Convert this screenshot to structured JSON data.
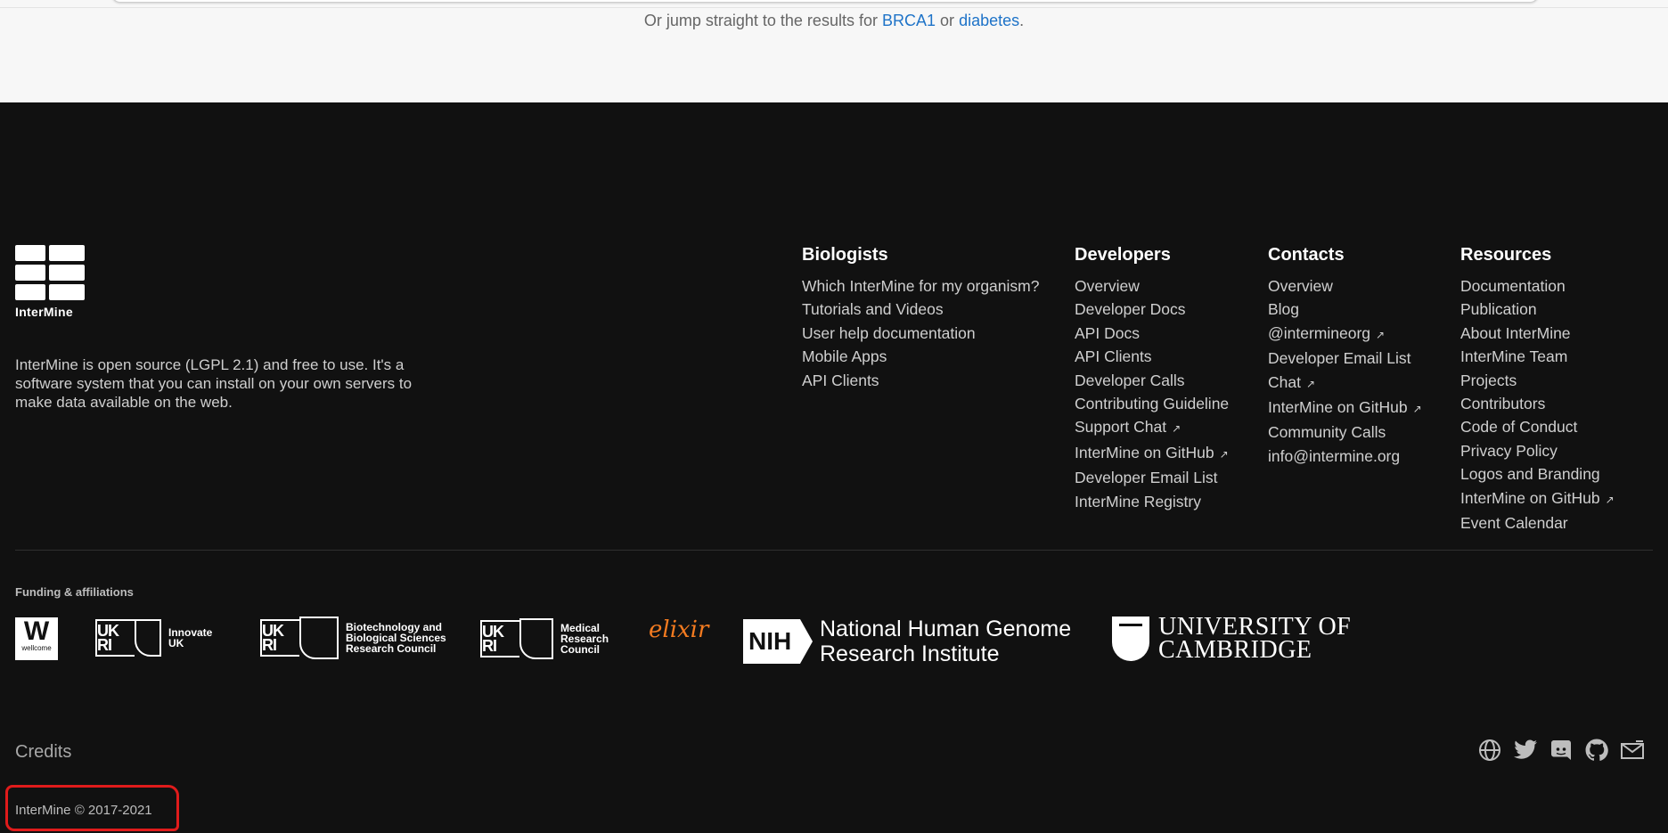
{
  "top": {
    "jump_prefix": "Or jump straight to the results for",
    "link_brca1": "BRCA1",
    "or": "or",
    "link_diabetes": "diabetes",
    "period": "."
  },
  "brand": {
    "logo_text": "InterMine",
    "about": "InterMine is open source (LGPL 2.1) and free to use. It's a software system that you can install on your own servers to make data available on the web."
  },
  "columns": [
    {
      "title": "Biologists",
      "items": [
        {
          "label": "Which InterMine for my organism?"
        },
        {
          "label": "Tutorials and Videos"
        },
        {
          "label": "User help documentation"
        },
        {
          "label": "Mobile Apps"
        },
        {
          "label": "API Clients"
        }
      ]
    },
    {
      "title": "Developers",
      "items": [
        {
          "label": "Overview"
        },
        {
          "label": "Developer Docs"
        },
        {
          "label": "API Docs"
        },
        {
          "label": "API Clients"
        },
        {
          "label": "Developer Calls"
        },
        {
          "label": "Contributing Guideline"
        },
        {
          "label": "Support Chat",
          "ext": "↗"
        },
        {
          "label": "InterMine on GitHub",
          "ext": "↗"
        },
        {
          "label": "Developer Email List"
        },
        {
          "label": "InterMine Registry"
        }
      ]
    },
    {
      "title": "Contacts",
      "items": [
        {
          "label": "Overview"
        },
        {
          "label": "Blog"
        },
        {
          "label": "@intermineorg",
          "ext": "↗"
        },
        {
          "label": "Developer Email List"
        },
        {
          "label": "Chat",
          "ext": "↗"
        },
        {
          "label": "InterMine on GitHub",
          "ext": "↗"
        },
        {
          "label": "Community Calls"
        },
        {
          "label": "info@intermine.org"
        }
      ]
    },
    {
      "title": "Resources",
      "items": [
        {
          "label": "Documentation"
        },
        {
          "label": "Publication"
        },
        {
          "label": "About InterMine"
        },
        {
          "label": "InterMine Team"
        },
        {
          "label": "Projects"
        },
        {
          "label": "Contributors"
        },
        {
          "label": "Code of Conduct"
        },
        {
          "label": "Privacy Policy"
        },
        {
          "label": "Logos and Branding"
        },
        {
          "label": "InterMine on GitHub",
          "ext": "↗"
        },
        {
          "label": "Event Calendar"
        }
      ]
    }
  ],
  "funding": {
    "heading": "Funding & affiliations",
    "wellcome": {
      "mark": "W",
      "text": "wellcome"
    },
    "ukri_mark": "UK RI",
    "innovate": {
      "line1": "Innovate",
      "line2": "UK"
    },
    "bbsrc": {
      "line1": "Biotechnology and",
      "line2": "Biological Sciences",
      "line3": "Research Council"
    },
    "mrc": {
      "line1": "Medical",
      "line2": "Research",
      "line3": "Council"
    },
    "elixir": "elixir",
    "nih": {
      "mark": "NIH",
      "line1": "National Human Genome",
      "line2": "Research Institute"
    },
    "cambridge": {
      "line1": "UNIVERSITY OF",
      "line2": "CAMBRIDGE"
    }
  },
  "bottom": {
    "credits": "Credits",
    "copyright": "InterMine © 2017-2021"
  },
  "social": [
    "globe-icon",
    "twitter-icon",
    "discord-icon",
    "github-icon",
    "mail-icon"
  ],
  "colors": {
    "link": "#1e73c8",
    "footer_bg": "#111111",
    "annotation": "#e01b1b",
    "elixir": "#f47b20"
  }
}
